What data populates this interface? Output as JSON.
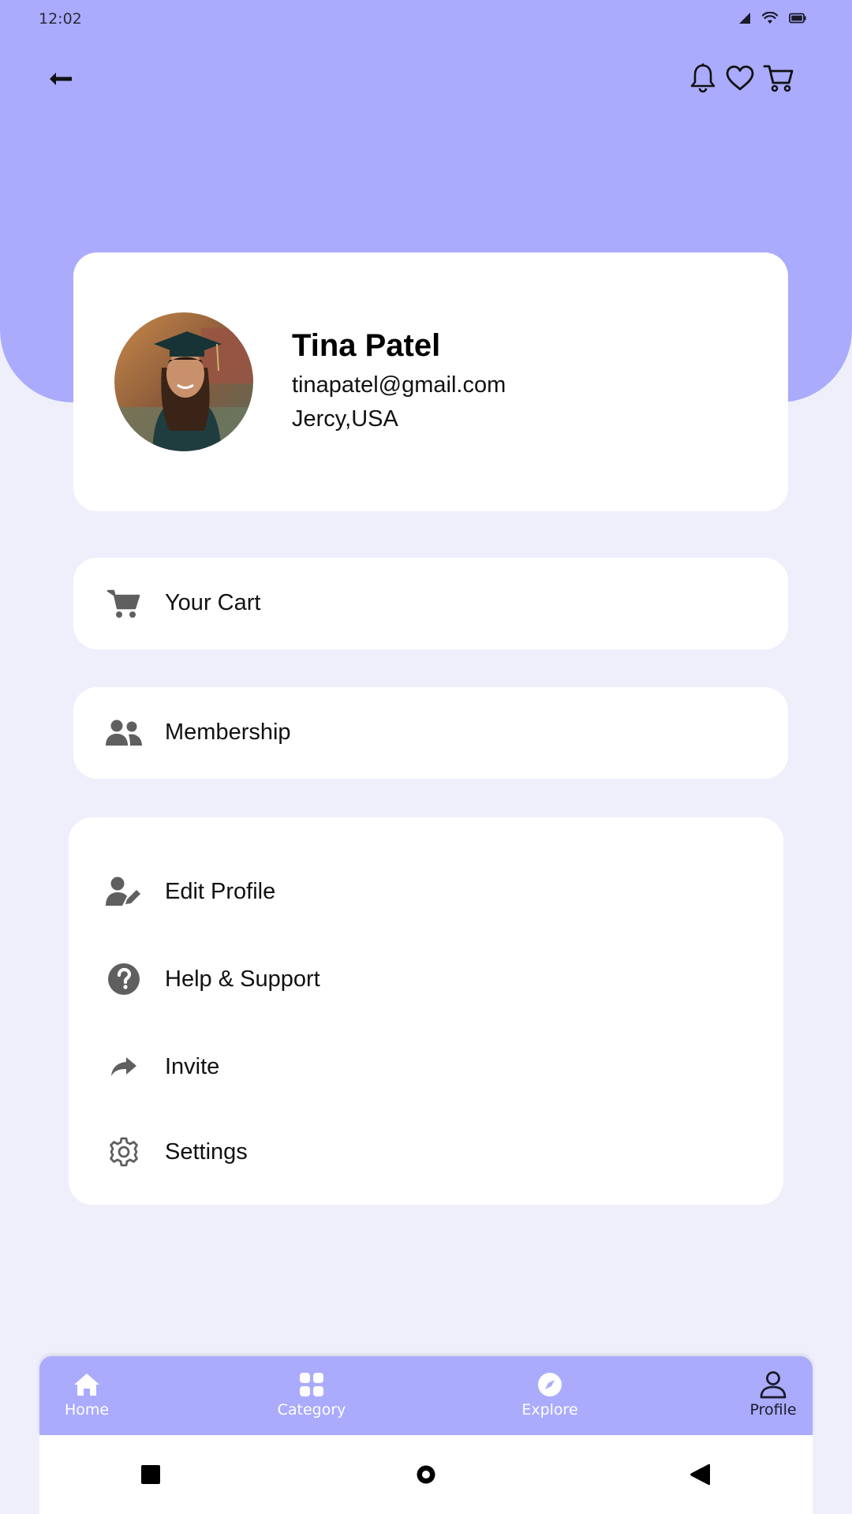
{
  "status_bar": {
    "time": "12:02"
  },
  "profile": {
    "name": "Tina Patel",
    "email": "tinapatel@gmail.com",
    "location": "Jercy,USA"
  },
  "rows": {
    "cart": "Your Cart",
    "membership": "Membership"
  },
  "menu": {
    "edit_profile": "Edit Profile",
    "help_support": "Help & Support",
    "invite": "Invite",
    "settings": "Settings"
  },
  "bottom_nav": {
    "home": "Home",
    "category": "Category",
    "explore": "Explore",
    "profile": "Profile",
    "active": "profile"
  },
  "colors": {
    "header": "#aaabfd",
    "background": "#efeffc",
    "card": "#ffffff",
    "icon": "#5f5f5f"
  },
  "icons": {
    "back": "arrow-left-icon",
    "notifications": "bell-icon",
    "wishlist": "heart-icon",
    "cart": "cart-icon"
  }
}
